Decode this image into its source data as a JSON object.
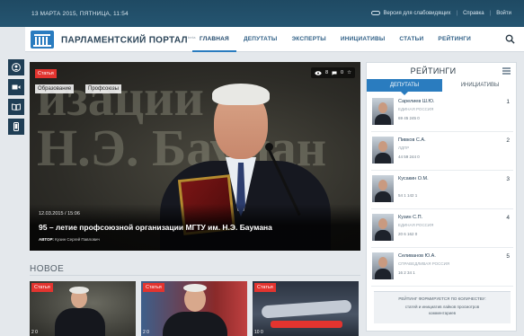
{
  "topbar": {
    "date": "13 МАРТА 2015, ПЯТНИЦА, 11:54",
    "accessibility": "Версия для слабовидящих",
    "help": "Справка",
    "login": "Войти"
  },
  "header": {
    "logo_title": "ПАРЛАМЕНТСКИЙ ПОРТАЛ",
    "logo_sup": "beta",
    "nav": [
      "ГЛАВНАЯ",
      "ДЕПУТАТЫ",
      "ЭКСПЕРТЫ",
      "ИНИЦИАТИВЫ",
      "СТАТЬИ",
      "РЕЙТИНГИ"
    ]
  },
  "hero": {
    "badge": "Статья",
    "wall_text": [
      "изации",
      "Н.Э. Бауман"
    ],
    "tags": [
      "Образование",
      "Профсоюзы"
    ],
    "stats": [
      "8",
      "0"
    ],
    "date": "12.03.2015 / 15:06",
    "title": "95 – летие профсоюзной организации МГТУ им. Н.Э. Баумана",
    "author_label": "АВТОР:",
    "author": "Кузин Сергей Павлович"
  },
  "new_section": {
    "title": "НОВОЕ",
    "cards": [
      {
        "badge": "Статья",
        "stats": "2  0"
      },
      {
        "badge": "Статья",
        "stats": "2  0"
      },
      {
        "badge": "Статья",
        "stats": "10  0"
      }
    ]
  },
  "ratings": {
    "title": "РЕЙТИНГИ",
    "tabs": [
      "ДЕПУТАТЫ",
      "ИНИЦИАТИВЫ"
    ],
    "items": [
      {
        "rank": "1",
        "name": "Сарелиев Ш.Ю.",
        "party": "ЕДИНАЯ РОССИЯ",
        "stats": "69    45    245    0"
      },
      {
        "rank": "2",
        "name": "Пивков С.А.",
        "party": "ЛДПР",
        "stats": "44    59    244    0"
      },
      {
        "rank": "3",
        "name": "Кусакин О.М.",
        "party": "",
        "stats": "54    1    142    1"
      },
      {
        "rank": "4",
        "name": "Кузин С.П.",
        "party": "ЕДИНАЯ РОССИЯ",
        "stats": "20    6    162    0"
      },
      {
        "rank": "5",
        "name": "Селиванов Ю.А.",
        "party": "СПРАВЕДЛИВАЯ РОССИЯ",
        "stats": "16    2    34    1"
      }
    ],
    "footer": {
      "line1": "РЕЙТИНГ ФОРМИРУЕТСЯ ПО КОЛИЧЕСТВУ:",
      "line2": "статей и инициатив    лайков    просмотров",
      "line3": "комментариев"
    }
  },
  "colors": {
    "accent": "#2a7cbf",
    "badge": "#e3342f",
    "topbar": "#1f4a63"
  }
}
